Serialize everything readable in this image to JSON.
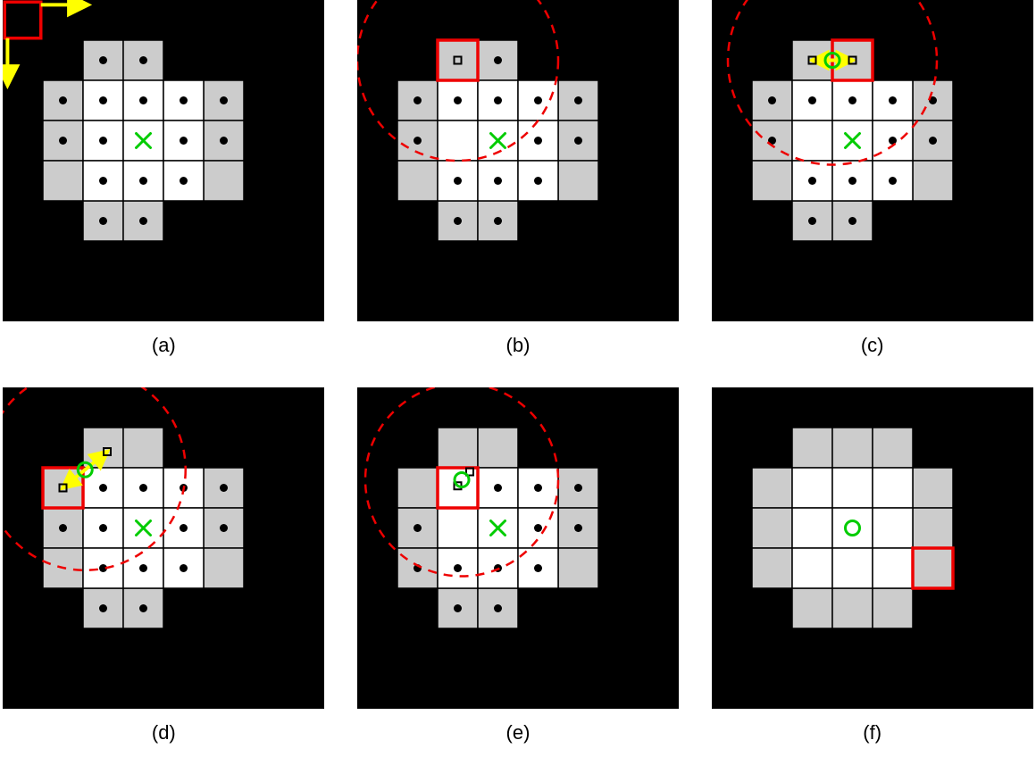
{
  "panels": [
    {
      "id": "a",
      "label": "(a)"
    },
    {
      "id": "b",
      "label": "(b)"
    },
    {
      "id": "c",
      "label": "(c)"
    },
    {
      "id": "d",
      "label": "(d)"
    },
    {
      "id": "e",
      "label": "(e)"
    },
    {
      "id": "f",
      "label": "(f)"
    }
  ],
  "colors": {
    "black": "#000000",
    "white": "#ffffff",
    "gray": "#cccccc",
    "red": "#ee0000",
    "yellow": "#ffff00",
    "green": "#00cc00"
  },
  "chart_data": {
    "type": "diagram",
    "description": "Six-panel algorithm step figure. Each panel is a black square field with a cross-shaped grid of cells (gray border + white interior). Symbols: green X = goal/center, red square outline = current/selected cell or cursor, dashed red circle = search radius, black filled dots = candidate centers, small open squares = sampled points, yellow arrows = direction / correspondence, green open circle = estimated point.",
    "panel_size_px": 360,
    "grid": {
      "cell_size": 45,
      "white_cells": [
        [
          2,
          2
        ],
        [
          3,
          2
        ],
        [
          4,
          2
        ],
        [
          2,
          3
        ],
        [
          3,
          3
        ],
        [
          4,
          3
        ],
        [
          2,
          4
        ],
        [
          3,
          4
        ],
        [
          4,
          4
        ]
      ],
      "gray_cells": [
        [
          2,
          1
        ],
        [
          3,
          1
        ],
        [
          1,
          2
        ],
        [
          5,
          2
        ],
        [
          1,
          3
        ],
        [
          5,
          3
        ],
        [
          1,
          4
        ],
        [
          5,
          4
        ],
        [
          2,
          5
        ],
        [
          3,
          5
        ]
      ],
      "goal_cell": [
        3,
        3
      ]
    },
    "panels": [
      {
        "id": "a",
        "dots_at": [
          [
            2,
            1
          ],
          [
            3,
            1
          ],
          [
            1,
            2
          ],
          [
            2,
            2
          ],
          [
            3,
            2
          ],
          [
            4,
            2
          ],
          [
            5,
            2
          ],
          [
            1,
            3
          ],
          [
            4,
            3
          ],
          [
            5,
            3
          ],
          [
            2,
            3
          ],
          [
            2,
            4
          ],
          [
            3,
            4
          ],
          [
            4,
            4
          ],
          [
            2,
            5
          ],
          [
            3,
            5
          ]
        ],
        "red_cursor_cell_topleft": true,
        "yellow_axes_at_topleft": true,
        "green_x_at_goal": true
      },
      {
        "id": "b",
        "dots_at": [
          [
            3,
            1
          ],
          [
            1,
            2
          ],
          [
            2,
            2
          ],
          [
            3,
            2
          ],
          [
            4,
            2
          ],
          [
            5,
            2
          ],
          [
            1,
            3
          ],
          [
            4,
            3
          ],
          [
            5,
            3
          ],
          [
            2,
            4
          ],
          [
            3,
            4
          ],
          [
            4,
            4
          ],
          [
            2,
            5
          ],
          [
            3,
            5
          ]
        ],
        "red_cursor_cell": [
          2,
          1
        ],
        "small_open_squares_at": [
          [
            2.5,
            1.5
          ]
        ],
        "dashed_circle_center_cell": [
          2.5,
          1.5
        ],
        "dashed_circle_radius_cells": 2.5,
        "green_x_at_goal": true
      },
      {
        "id": "c",
        "dots_at": [
          [
            1,
            2
          ],
          [
            2,
            2
          ],
          [
            3,
            2
          ],
          [
            4,
            2
          ],
          [
            5,
            2
          ],
          [
            1,
            3
          ],
          [
            4,
            3
          ],
          [
            5,
            3
          ],
          [
            2,
            4
          ],
          [
            3,
            4
          ],
          [
            4,
            4
          ],
          [
            2,
            5
          ],
          [
            3,
            5
          ]
        ],
        "red_cursor_cell": [
          3,
          1
        ],
        "small_open_squares_at": [
          [
            2.5,
            1.5
          ],
          [
            3.5,
            1.5
          ]
        ],
        "yellow_arrow": {
          "from_cell": [
            2.5,
            1.5
          ],
          "to_cell": [
            3.5,
            1.5
          ]
        },
        "green_open_circle_at_cell": [
          3.0,
          1.5
        ],
        "dashed_circle_center_cell": [
          3.0,
          1.5
        ],
        "dashed_circle_radius_cells": 2.6,
        "green_x_at_goal": true
      },
      {
        "id": "d",
        "dots_at": [
          [
            2,
            2
          ],
          [
            3,
            2
          ],
          [
            4,
            2
          ],
          [
            5,
            2
          ],
          [
            1,
            3
          ],
          [
            2,
            3
          ],
          [
            4,
            3
          ],
          [
            5,
            3
          ],
          [
            2,
            4
          ],
          [
            3,
            4
          ],
          [
            4,
            4
          ],
          [
            2,
            5
          ],
          [
            3,
            5
          ]
        ],
        "red_cursor_cell": [
          1,
          2
        ],
        "small_open_squares_at": [
          [
            1.5,
            2.5
          ],
          [
            2.6,
            1.6
          ]
        ],
        "yellow_arrow": {
          "from_cell": [
            2.6,
            1.6
          ],
          "to_cell": [
            1.5,
            2.5
          ]
        },
        "green_open_circle_at_cell": [
          2.05,
          2.05
        ],
        "dashed_circle_center_cell": [
          2.05,
          2.05
        ],
        "dashed_circle_radius_cells": 2.5,
        "green_x_at_goal": true
      },
      {
        "id": "e",
        "dots_at": [
          [
            3,
            2
          ],
          [
            4,
            2
          ],
          [
            5,
            2
          ],
          [
            1,
            3
          ],
          [
            4,
            3
          ],
          [
            5,
            3
          ],
          [
            1,
            4
          ],
          [
            2,
            4
          ],
          [
            3,
            4
          ],
          [
            4,
            4
          ],
          [
            2,
            5
          ],
          [
            3,
            5
          ]
        ],
        "red_cursor_cell": [
          2,
          2
        ],
        "small_open_squares_at": [
          [
            2.8,
            2.1
          ],
          [
            2.5,
            2.45
          ]
        ],
        "green_open_circle_at_cell": [
          2.6,
          2.3
        ],
        "dashed_circle_center_cell": [
          2.6,
          2.3
        ],
        "dashed_circle_radius_cells": 2.4,
        "green_x_at_goal": true
      },
      {
        "id": "f",
        "dots_at": [],
        "red_cursor_cell": [
          5,
          4
        ],
        "green_open_circle_at_cell": [
          3.5,
          3.5
        ],
        "extra_gray_cells": [
          [
            4,
            1
          ],
          [
            4,
            5
          ],
          [
            5,
            4
          ]
        ]
      }
    ]
  }
}
